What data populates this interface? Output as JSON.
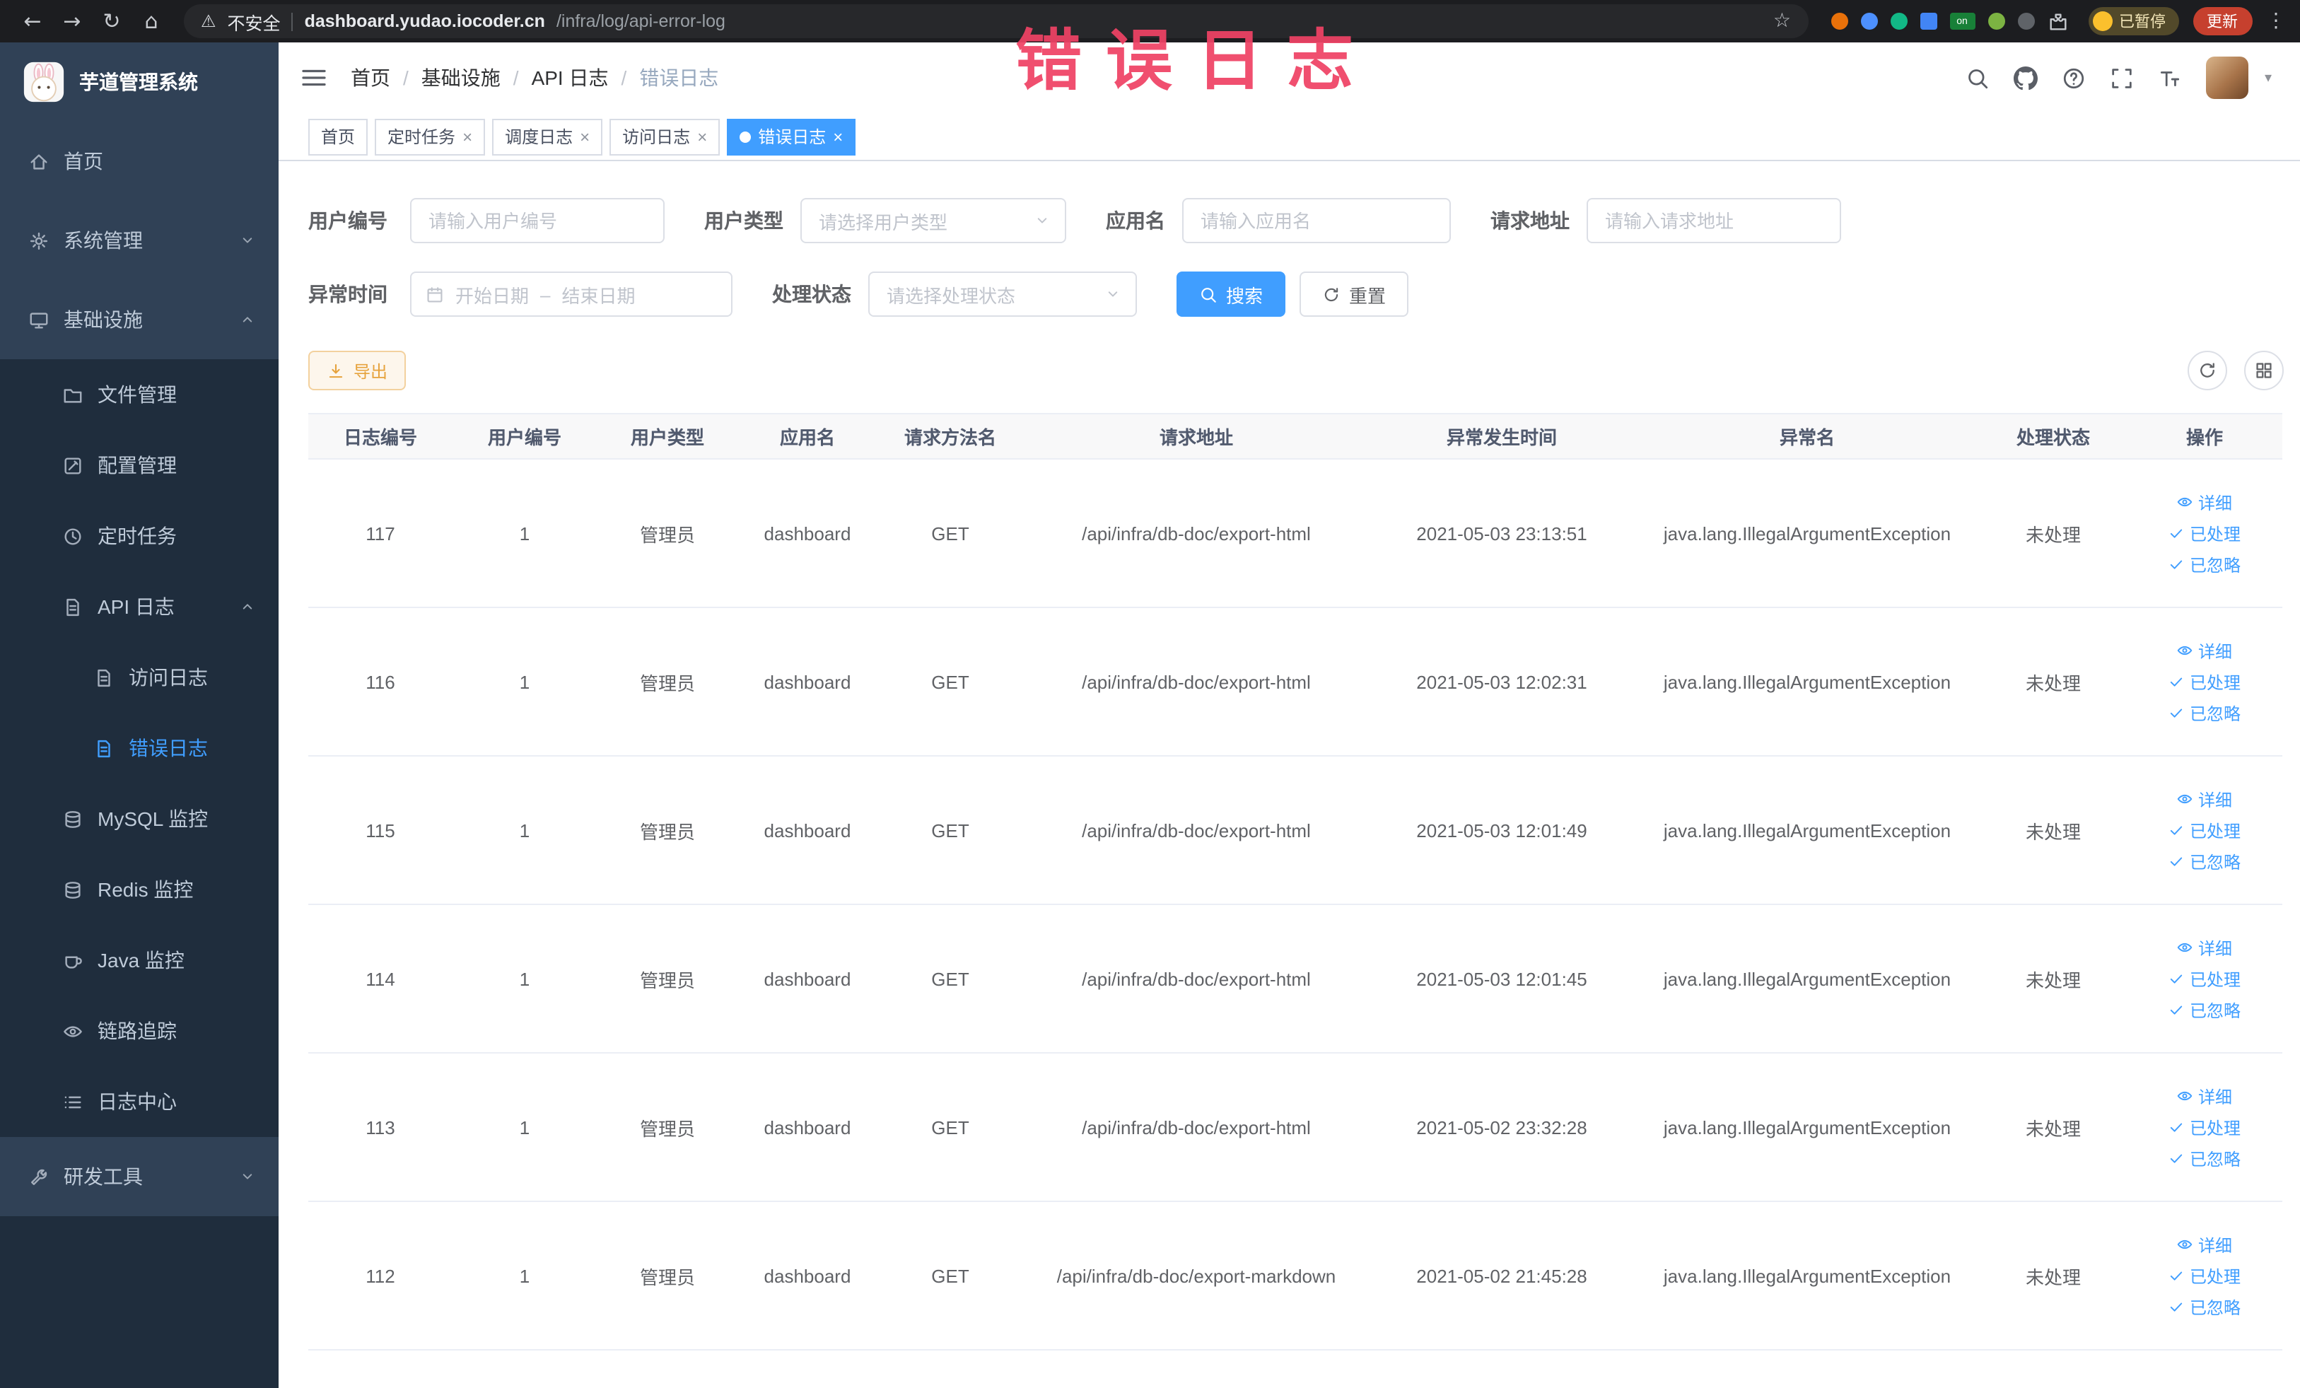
{
  "browser": {
    "security_label": "不安全",
    "url_host": "dashboard.yudao.iocoder.cn",
    "url_path": "/infra/log/api-error-log",
    "extension_badge": "on",
    "paused_chip": "已暂停",
    "update_button": "更新"
  },
  "annotation": {
    "text": "错误日志"
  },
  "sidebar": {
    "logo_title": "芋道管理系统",
    "items": [
      {
        "label": "首页"
      },
      {
        "label": "系统管理"
      },
      {
        "label": "基础设施"
      },
      {
        "label": "文件管理"
      },
      {
        "label": "配置管理"
      },
      {
        "label": "定时任务"
      },
      {
        "label": "API 日志"
      },
      {
        "label": "访问日志"
      },
      {
        "label": "错误日志"
      },
      {
        "label": "MySQL 监控"
      },
      {
        "label": "Redis 监控"
      },
      {
        "label": "Java 监控"
      },
      {
        "label": "链路追踪"
      },
      {
        "label": "日志中心"
      },
      {
        "label": "研发工具"
      }
    ]
  },
  "breadcrumb": {
    "items": [
      "首页",
      "基础设施",
      "API 日志",
      "错误日志"
    ]
  },
  "tabs": [
    {
      "label": "首页"
    },
    {
      "label": "定时任务"
    },
    {
      "label": "调度日志"
    },
    {
      "label": "访问日志"
    },
    {
      "label": "错误日志"
    }
  ],
  "filters": {
    "user_id_label": "用户编号",
    "user_id_placeholder": "请输入用户编号",
    "user_type_label": "用户类型",
    "user_type_placeholder": "请选择用户类型",
    "app_name_label": "应用名",
    "app_name_placeholder": "请输入应用名",
    "request_url_label": "请求地址",
    "request_url_placeholder": "请输入请求地址",
    "exception_time_label": "异常时间",
    "date_start_placeholder": "开始日期",
    "date_end_placeholder": "结束日期",
    "process_status_label": "处理状态",
    "process_status_placeholder": "请选择处理状态",
    "search_button": "搜索",
    "reset_button": "重置"
  },
  "toolbar": {
    "export_button": "导出"
  },
  "table": {
    "columns": [
      "日志编号",
      "用户编号",
      "用户类型",
      "应用名",
      "请求方法名",
      "请求地址",
      "异常发生时间",
      "异常名",
      "处理状态",
      "操作"
    ],
    "action_labels": {
      "detail": "详细",
      "resolve": "已处理",
      "ignore": "已忽略"
    },
    "rows": [
      {
        "log_id": "117",
        "user_id": "1",
        "user_type": "管理员",
        "app_name": "dashboard",
        "method": "GET",
        "url": "/api/infra/db-doc/export-html",
        "time": "2021-05-03 23:13:51",
        "exception": "java.lang.IllegalArgumentException",
        "status": "未处理"
      },
      {
        "log_id": "116",
        "user_id": "1",
        "user_type": "管理员",
        "app_name": "dashboard",
        "method": "GET",
        "url": "/api/infra/db-doc/export-html",
        "time": "2021-05-03 12:02:31",
        "exception": "java.lang.IllegalArgumentException",
        "status": "未处理"
      },
      {
        "log_id": "115",
        "user_id": "1",
        "user_type": "管理员",
        "app_name": "dashboard",
        "method": "GET",
        "url": "/api/infra/db-doc/export-html",
        "time": "2021-05-03 12:01:49",
        "exception": "java.lang.IllegalArgumentException",
        "status": "未处理"
      },
      {
        "log_id": "114",
        "user_id": "1",
        "user_type": "管理员",
        "app_name": "dashboard",
        "method": "GET",
        "url": "/api/infra/db-doc/export-html",
        "time": "2021-05-03 12:01:45",
        "exception": "java.lang.IllegalArgumentException",
        "status": "未处理"
      },
      {
        "log_id": "113",
        "user_id": "1",
        "user_type": "管理员",
        "app_name": "dashboard",
        "method": "GET",
        "url": "/api/infra/db-doc/export-html",
        "time": "2021-05-02 23:32:28",
        "exception": "java.lang.IllegalArgumentException",
        "status": "未处理"
      },
      {
        "log_id": "112",
        "user_id": "1",
        "user_type": "管理员",
        "app_name": "dashboard",
        "method": "GET",
        "url": "/api/infra/db-doc/export-markdown",
        "time": "2021-05-02 21:45:28",
        "exception": "java.lang.IllegalArgumentException",
        "status": "未处理"
      }
    ]
  }
}
